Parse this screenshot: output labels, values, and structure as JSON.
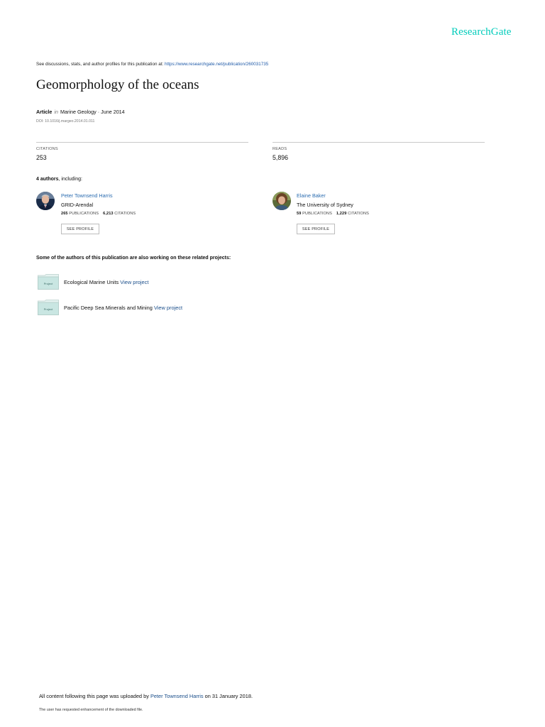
{
  "brand": {
    "logo": "ResearchGate",
    "accent_color": "#00ccbb"
  },
  "disclaimer": {
    "text": "See discussions, stats, and author profiles for this publication at: ",
    "url": "https://www.researchgate.net/publication/260031735"
  },
  "publication": {
    "title": "Geomorphology of the oceans",
    "type": "Article",
    "in_label": "in",
    "venue": "Marine Geology · June 2014",
    "doi": "DOI: 10.1016/j.margeo.2014.01.011"
  },
  "stats": {
    "citations_label": "CITATIONS",
    "citations": "253",
    "reads_label": "READS",
    "reads": "5,896"
  },
  "authors_header": {
    "count": "4 authors",
    "suffix": ", including:"
  },
  "authors": [
    {
      "name": "Peter Townsend Harris",
      "institution": "GRID-Arendal",
      "publications": "265",
      "publications_label": "PUBLICATIONS",
      "citations": "6,213",
      "citations_label": "CITATIONS",
      "button": "SEE PROFILE"
    },
    {
      "name": "Elaine Baker",
      "institution": "The University of Sydney",
      "publications": "59",
      "publications_label": "PUBLICATIONS",
      "citations": "1,229",
      "citations_label": "CITATIONS",
      "button": "SEE PROFILE"
    }
  ],
  "projects_header": "Some of the authors of this publication are also working on these related projects:",
  "projects": [
    {
      "icon_label": "Project",
      "name": "Ecological Marine Units",
      "link": "View project"
    },
    {
      "icon_label": "Project",
      "name": "Pacific Deep Sea Minerals and Mining",
      "link": "View project"
    }
  ],
  "footer": {
    "uploaded_prefix": "All content following this page was uploaded by ",
    "uploader": "Peter Townsend Harris",
    "uploaded_suffix": " on 31 January 2018.",
    "note": "The user has requested enhancement of the downloaded file."
  }
}
